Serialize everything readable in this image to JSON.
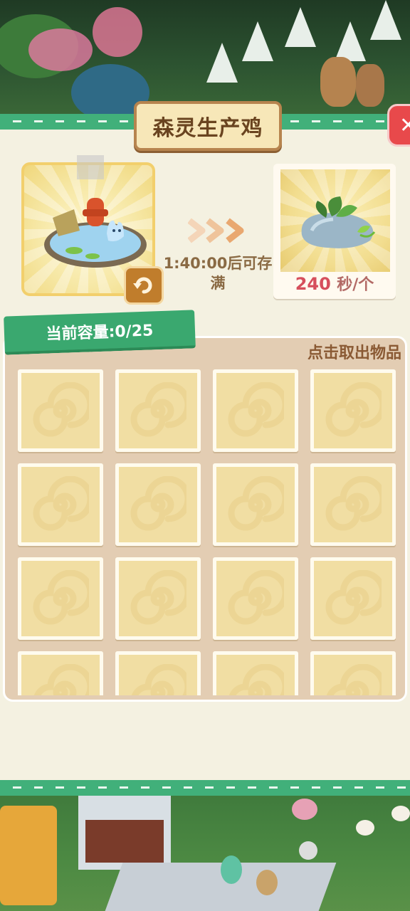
{
  "dialog": {
    "title": "森灵生产鸡",
    "close_label": "✕"
  },
  "production": {
    "time_text": "1:40:00后可存满",
    "rate_value": "240",
    "rate_unit": "秒/个"
  },
  "storage": {
    "capacity_label": "当前容量:0/25",
    "take_hint": "点击取出物品",
    "slots": 16
  },
  "colors": {
    "accent_green": "#41b07a",
    "panel_bg": "#f4f1e1",
    "title_brown": "#6a4420",
    "rate_red": "#d64f5c",
    "close_red": "#e8494b"
  },
  "icons": [
    "refresh-icon",
    "chevron-right-icon",
    "close-icon",
    "spiral-slot-icon"
  ]
}
